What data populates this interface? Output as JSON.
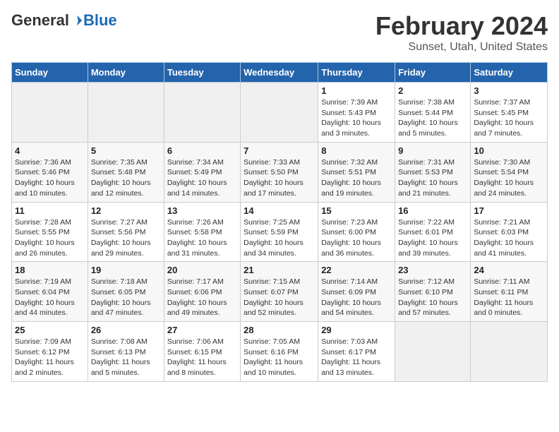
{
  "header": {
    "logo_general": "General",
    "logo_blue": "Blue",
    "title": "February 2024",
    "subtitle": "Sunset, Utah, United States"
  },
  "columns": [
    "Sunday",
    "Monday",
    "Tuesday",
    "Wednesday",
    "Thursday",
    "Friday",
    "Saturday"
  ],
  "weeks": [
    [
      {
        "day": "",
        "detail": ""
      },
      {
        "day": "",
        "detail": ""
      },
      {
        "day": "",
        "detail": ""
      },
      {
        "day": "",
        "detail": ""
      },
      {
        "day": "1",
        "detail": "Sunrise: 7:39 AM\nSunset: 5:43 PM\nDaylight: 10 hours\nand 3 minutes."
      },
      {
        "day": "2",
        "detail": "Sunrise: 7:38 AM\nSunset: 5:44 PM\nDaylight: 10 hours\nand 5 minutes."
      },
      {
        "day": "3",
        "detail": "Sunrise: 7:37 AM\nSunset: 5:45 PM\nDaylight: 10 hours\nand 7 minutes."
      }
    ],
    [
      {
        "day": "4",
        "detail": "Sunrise: 7:36 AM\nSunset: 5:46 PM\nDaylight: 10 hours\nand 10 minutes."
      },
      {
        "day": "5",
        "detail": "Sunrise: 7:35 AM\nSunset: 5:48 PM\nDaylight: 10 hours\nand 12 minutes."
      },
      {
        "day": "6",
        "detail": "Sunrise: 7:34 AM\nSunset: 5:49 PM\nDaylight: 10 hours\nand 14 minutes."
      },
      {
        "day": "7",
        "detail": "Sunrise: 7:33 AM\nSunset: 5:50 PM\nDaylight: 10 hours\nand 17 minutes."
      },
      {
        "day": "8",
        "detail": "Sunrise: 7:32 AM\nSunset: 5:51 PM\nDaylight: 10 hours\nand 19 minutes."
      },
      {
        "day": "9",
        "detail": "Sunrise: 7:31 AM\nSunset: 5:53 PM\nDaylight: 10 hours\nand 21 minutes."
      },
      {
        "day": "10",
        "detail": "Sunrise: 7:30 AM\nSunset: 5:54 PM\nDaylight: 10 hours\nand 24 minutes."
      }
    ],
    [
      {
        "day": "11",
        "detail": "Sunrise: 7:28 AM\nSunset: 5:55 PM\nDaylight: 10 hours\nand 26 minutes."
      },
      {
        "day": "12",
        "detail": "Sunrise: 7:27 AM\nSunset: 5:56 PM\nDaylight: 10 hours\nand 29 minutes."
      },
      {
        "day": "13",
        "detail": "Sunrise: 7:26 AM\nSunset: 5:58 PM\nDaylight: 10 hours\nand 31 minutes."
      },
      {
        "day": "14",
        "detail": "Sunrise: 7:25 AM\nSunset: 5:59 PM\nDaylight: 10 hours\nand 34 minutes."
      },
      {
        "day": "15",
        "detail": "Sunrise: 7:23 AM\nSunset: 6:00 PM\nDaylight: 10 hours\nand 36 minutes."
      },
      {
        "day": "16",
        "detail": "Sunrise: 7:22 AM\nSunset: 6:01 PM\nDaylight: 10 hours\nand 39 minutes."
      },
      {
        "day": "17",
        "detail": "Sunrise: 7:21 AM\nSunset: 6:03 PM\nDaylight: 10 hours\nand 41 minutes."
      }
    ],
    [
      {
        "day": "18",
        "detail": "Sunrise: 7:19 AM\nSunset: 6:04 PM\nDaylight: 10 hours\nand 44 minutes."
      },
      {
        "day": "19",
        "detail": "Sunrise: 7:18 AM\nSunset: 6:05 PM\nDaylight: 10 hours\nand 47 minutes."
      },
      {
        "day": "20",
        "detail": "Sunrise: 7:17 AM\nSunset: 6:06 PM\nDaylight: 10 hours\nand 49 minutes."
      },
      {
        "day": "21",
        "detail": "Sunrise: 7:15 AM\nSunset: 6:07 PM\nDaylight: 10 hours\nand 52 minutes."
      },
      {
        "day": "22",
        "detail": "Sunrise: 7:14 AM\nSunset: 6:09 PM\nDaylight: 10 hours\nand 54 minutes."
      },
      {
        "day": "23",
        "detail": "Sunrise: 7:12 AM\nSunset: 6:10 PM\nDaylight: 10 hours\nand 57 minutes."
      },
      {
        "day": "24",
        "detail": "Sunrise: 7:11 AM\nSunset: 6:11 PM\nDaylight: 11 hours\nand 0 minutes."
      }
    ],
    [
      {
        "day": "25",
        "detail": "Sunrise: 7:09 AM\nSunset: 6:12 PM\nDaylight: 11 hours\nand 2 minutes."
      },
      {
        "day": "26",
        "detail": "Sunrise: 7:08 AM\nSunset: 6:13 PM\nDaylight: 11 hours\nand 5 minutes."
      },
      {
        "day": "27",
        "detail": "Sunrise: 7:06 AM\nSunset: 6:15 PM\nDaylight: 11 hours\nand 8 minutes."
      },
      {
        "day": "28",
        "detail": "Sunrise: 7:05 AM\nSunset: 6:16 PM\nDaylight: 11 hours\nand 10 minutes."
      },
      {
        "day": "29",
        "detail": "Sunrise: 7:03 AM\nSunset: 6:17 PM\nDaylight: 11 hours\nand 13 minutes."
      },
      {
        "day": "",
        "detail": ""
      },
      {
        "day": "",
        "detail": ""
      }
    ]
  ]
}
